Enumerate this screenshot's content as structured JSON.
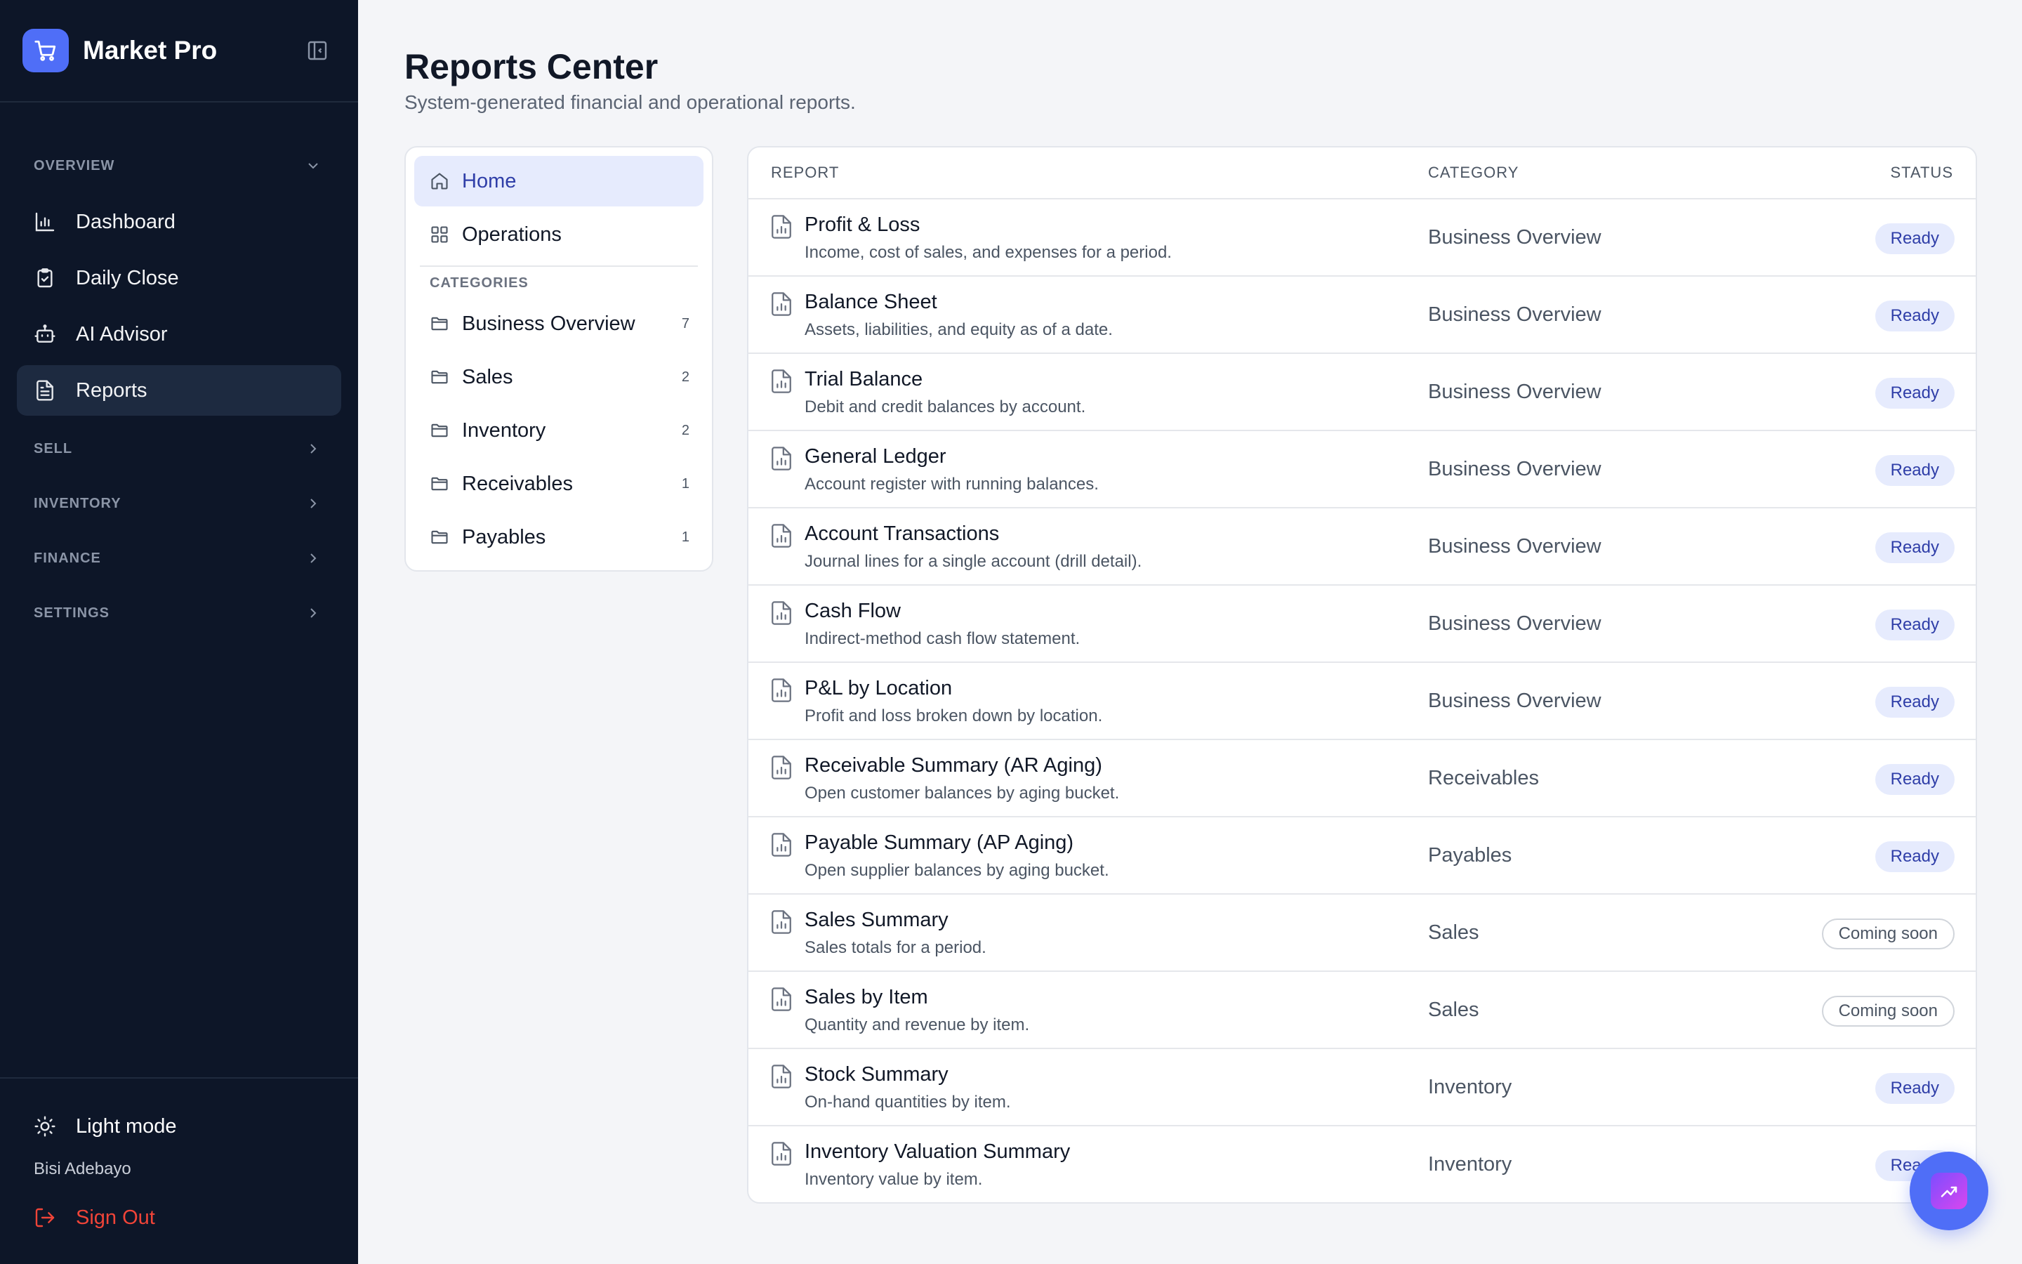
{
  "brand": {
    "name": "Market Pro"
  },
  "nav": {
    "sections": [
      {
        "label": "OVERVIEW",
        "items": [
          {
            "label": "Dashboard",
            "icon": "bar-chart-icon"
          },
          {
            "label": "Daily Close",
            "icon": "clipboard-check-icon"
          },
          {
            "label": "AI Advisor",
            "icon": "robot-icon"
          },
          {
            "label": "Reports",
            "icon": "file-text-icon",
            "active": true
          }
        ]
      },
      {
        "label": "SELL"
      },
      {
        "label": "INVENTORY"
      },
      {
        "label": "FINANCE"
      },
      {
        "label": "SETTINGS"
      }
    ]
  },
  "sidebar_bottom": {
    "theme_label": "Light mode",
    "user": "Bisi Adebayo",
    "signout_label": "Sign Out"
  },
  "page": {
    "title": "Reports Center",
    "subtitle": "System-generated financial and operational reports."
  },
  "categories_panel": {
    "top": [
      {
        "label": "Home",
        "icon": "home-icon",
        "active": true
      },
      {
        "label": "Operations",
        "icon": "grid-icon"
      }
    ],
    "heading": "CATEGORIES",
    "items": [
      {
        "label": "Business Overview",
        "count": "7"
      },
      {
        "label": "Sales",
        "count": "2"
      },
      {
        "label": "Inventory",
        "count": "2"
      },
      {
        "label": "Receivables",
        "count": "1"
      },
      {
        "label": "Payables",
        "count": "1"
      }
    ]
  },
  "table": {
    "headers": {
      "report": "REPORT",
      "category": "CATEGORY",
      "status": "STATUS"
    },
    "rows": [
      {
        "title": "Profit & Loss",
        "desc": "Income, cost of sales, and expenses for a period.",
        "category": "Business Overview",
        "status": "Ready"
      },
      {
        "title": "Balance Sheet",
        "desc": "Assets, liabilities, and equity as of a date.",
        "category": "Business Overview",
        "status": "Ready"
      },
      {
        "title": "Trial Balance",
        "desc": "Debit and credit balances by account.",
        "category": "Business Overview",
        "status": "Ready"
      },
      {
        "title": "General Ledger",
        "desc": "Account register with running balances.",
        "category": "Business Overview",
        "status": "Ready"
      },
      {
        "title": "Account Transactions",
        "desc": "Journal lines for a single account (drill detail).",
        "category": "Business Overview",
        "status": "Ready"
      },
      {
        "title": "Cash Flow",
        "desc": "Indirect-method cash flow statement.",
        "category": "Business Overview",
        "status": "Ready"
      },
      {
        "title": "P&L by Location",
        "desc": "Profit and loss broken down by location.",
        "category": "Business Overview",
        "status": "Ready"
      },
      {
        "title": "Receivable Summary (AR Aging)",
        "desc": "Open customer balances by aging bucket.",
        "category": "Receivables",
        "status": "Ready"
      },
      {
        "title": "Payable Summary (AP Aging)",
        "desc": "Open supplier balances by aging bucket.",
        "category": "Payables",
        "status": "Ready"
      },
      {
        "title": "Sales Summary",
        "desc": "Sales totals for a period.",
        "category": "Sales",
        "status": "Coming soon"
      },
      {
        "title": "Sales by Item",
        "desc": "Quantity and revenue by item.",
        "category": "Sales",
        "status": "Coming soon"
      },
      {
        "title": "Stock Summary",
        "desc": "On-hand quantities by item.",
        "category": "Inventory",
        "status": "Ready"
      },
      {
        "title": "Inventory Valuation Summary",
        "desc": "Inventory value by item.",
        "category": "Inventory",
        "status": "Ready"
      }
    ]
  },
  "colors": {
    "accent": "#4f6ef7",
    "sidebar_bg": "#0d1628",
    "ready_bg": "#e6ebfd",
    "ready_text": "#2f3ea8",
    "danger": "#f04438"
  }
}
